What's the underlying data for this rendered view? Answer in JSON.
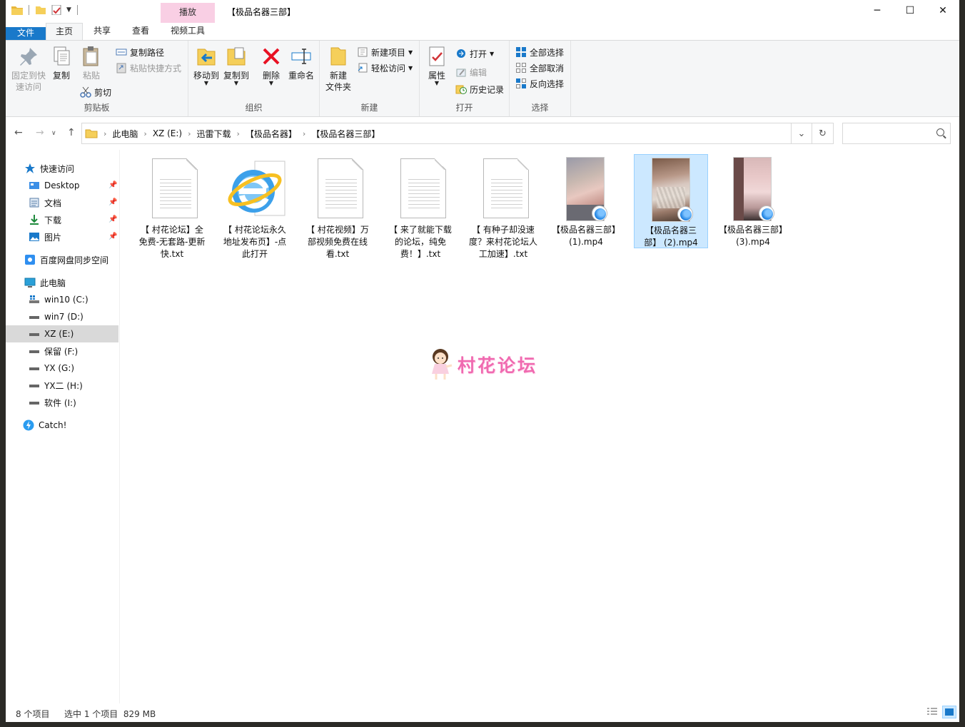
{
  "window": {
    "title": "【极品名器三部】",
    "contextual_tab": "播放",
    "controls": {
      "minimize": "─",
      "maximize": "☐",
      "close": "✕"
    }
  },
  "ribbon_tabs": [
    {
      "label": "文件"
    },
    {
      "label": "主页"
    },
    {
      "label": "共享"
    },
    {
      "label": "查看"
    },
    {
      "label": "视频工具"
    }
  ],
  "ribbon": {
    "clipboard": {
      "label": "剪贴板",
      "pin": "固定到快\n速访问",
      "copy": "复制",
      "paste": "粘贴",
      "copy_path": "复制路径",
      "paste_shortcut": "粘贴快捷方式",
      "cut": "剪切"
    },
    "organize": {
      "label": "组织",
      "move_to": "移动到",
      "copy_to": "复制到",
      "delete": "删除",
      "rename": "重命名"
    },
    "new": {
      "label": "新建",
      "new_folder": "新建\n文件夹",
      "new_item": "新建项目",
      "easy_access": "轻松访问"
    },
    "open": {
      "label": "打开",
      "properties": "属性",
      "open": "打开",
      "edit": "编辑",
      "history": "历史记录"
    },
    "select": {
      "label": "选择",
      "select_all": "全部选择",
      "select_none": "全部取消",
      "invert": "反向选择"
    }
  },
  "address": {
    "crumbs": [
      "此电脑",
      "XZ (E:)",
      "迅雷下载",
      "【极品名器】",
      "【极品名器三部】"
    ],
    "search_placeholder": ""
  },
  "nav_pane": {
    "quick_access": "快速访问",
    "quick_items": [
      {
        "label": "Desktop"
      },
      {
        "label": "文档"
      },
      {
        "label": "下载"
      },
      {
        "label": "图片"
      }
    ],
    "baidu": "百度网盘同步空间",
    "this_pc": "此电脑",
    "drives": [
      {
        "label": "win10 (C:)"
      },
      {
        "label": "win7 (D:)"
      },
      {
        "label": "XZ (E:)"
      },
      {
        "label": "保留 (F:)"
      },
      {
        "label": "YX (G:)"
      },
      {
        "label": "YX二 (H:)"
      },
      {
        "label": "软件 (I:)"
      }
    ],
    "catch": "Catch!"
  },
  "files": [
    {
      "name": "【 村花论坛】全免费-无套路-更新快.txt",
      "type": "txt"
    },
    {
      "name": "【 村花论坛永久地址发布页】-点此打开",
      "type": "ie"
    },
    {
      "name": "【 村花视频】万部视频免费在线看.txt",
      "type": "txt"
    },
    {
      "name": "【 来了就能下载的论坛，纯免费！】.txt",
      "type": "txt"
    },
    {
      "name": "【 有种子却没速度？来村花论坛人工加速】.txt",
      "type": "txt"
    },
    {
      "name": "【极品名器三部】 (1).mp4",
      "type": "mp4"
    },
    {
      "name": "【极品名器三部】 (2).mp4",
      "type": "mp4",
      "selected": true
    },
    {
      "name": "【极品名器三部】 (3).mp4",
      "type": "mp4"
    }
  ],
  "watermark": "村花论坛",
  "status": {
    "count": "8 个项目",
    "selection": "选中 1 个项目  829 MB"
  },
  "colors": {
    "accent": "#1979ca",
    "selection": "#cce8ff",
    "context_tab": "#f9cfe4",
    "watermark": "#f06ab0"
  }
}
